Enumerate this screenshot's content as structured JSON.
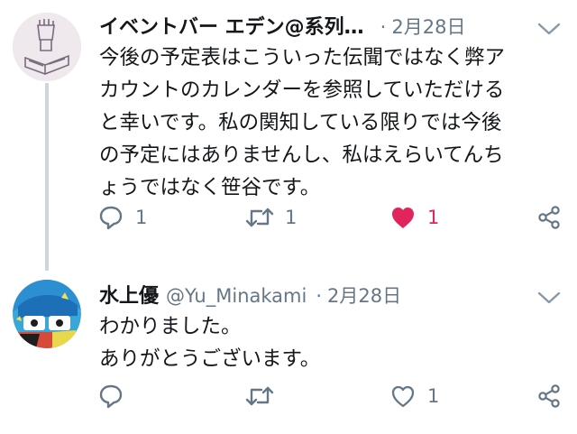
{
  "colors": {
    "text": "#14171a",
    "muted": "#657786",
    "like": "#e0245e",
    "thread_line": "#ccd6dd"
  },
  "tweets": [
    {
      "name": "イベントバー エデン@系列…",
      "handle": "",
      "date": "2月28日",
      "avatar_icon": "fist-book-sketch",
      "lines": [
        "今後の予定表はこういった伝聞ではなく弊ア",
        "カウントのカレンダーを参照していただける",
        "と幸いです。私の関知している限りでは今後",
        "の予定にはありませんし、私はえらいてんち",
        "ょうではなく笹谷です。"
      ],
      "reply_count": "1",
      "retweet_count": "1",
      "like_count": "1",
      "liked": true
    },
    {
      "name": "水上優",
      "handle": "@Yu_Minakami",
      "date": "2月28日",
      "avatar_icon": "colorful-drawing-avatar",
      "lines": [
        "わかりました。",
        "ありがとうございます。"
      ],
      "reply_count": "",
      "retweet_count": "",
      "like_count": "1",
      "liked": false
    }
  ]
}
